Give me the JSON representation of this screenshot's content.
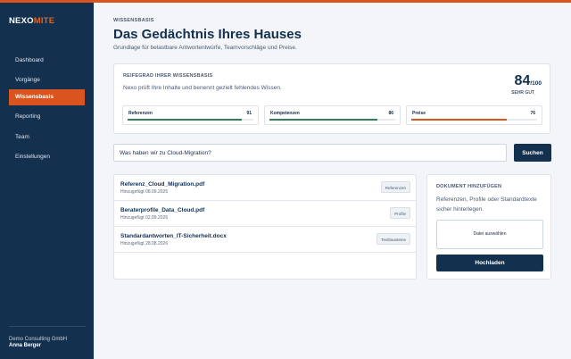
{
  "brand": {
    "name_main": "NEXO",
    "name_accent": "MITE",
    "accent_color": "#d9541e",
    "sidebar_color": "#13304f"
  },
  "sidebar": {
    "items": [
      {
        "label": "Dashboard",
        "active": false
      },
      {
        "label": "Vorgänge",
        "active": false
      },
      {
        "label": "Wissensbasis",
        "active": true
      },
      {
        "label": "Reporting",
        "active": false
      },
      {
        "label": "Team",
        "active": false
      },
      {
        "label": "Einstellungen",
        "active": false
      }
    ],
    "company": "Demo Consulting GmbH",
    "user": "Anna Berger"
  },
  "header": {
    "breadcrumb": "WISSENSBASIS",
    "title": "Das Gedächtnis Ihres Hauses",
    "subtitle": "Grundlage für belastbare Antwortentwürfe, Teamvorschläge und Preise."
  },
  "readiness": {
    "label": "REIFEGRAD IHRER WISSENSBASIS",
    "description": "Nexo prüft Ihre Inhalte und benennt gezielt fehlendes Wissen.",
    "score": "84",
    "score_max": "/100",
    "score_label": "SEHR GUT",
    "metrics": [
      {
        "name": "Referenzen",
        "value": "91",
        "percent": 91,
        "color": "#2e7d5b"
      },
      {
        "name": "Kompetenzen",
        "value": "86",
        "percent": 86,
        "color": "#2e7d5b"
      },
      {
        "name": "Preise",
        "value": "76",
        "percent": 76,
        "color": "#d9541e"
      }
    ]
  },
  "search": {
    "value": "Was haben wir zu Cloud-Migration?",
    "button_label": "Suchen"
  },
  "documents": [
    {
      "name": "Referenz_Cloud_Migration.pdf",
      "date": "Hinzugefügt 08.09.2026",
      "tag": "Referenzen"
    },
    {
      "name": "Beraterprofile_Data_Cloud.pdf",
      "date": "Hinzugefügt 02.09.2026",
      "tag": "Profile"
    },
    {
      "name": "Standardantworten_IT-Sicherheit.docx",
      "date": "Hinzugefügt 28.08.2026",
      "tag": "Textbausteine"
    }
  ],
  "upload": {
    "title": "DOKUMENT HINZUFÜGEN",
    "description": "Referenzen, Profile oder Standardtexte sicher hinterlegen.",
    "file_label": "Datei auswählen",
    "button_label": "Hochladen"
  }
}
